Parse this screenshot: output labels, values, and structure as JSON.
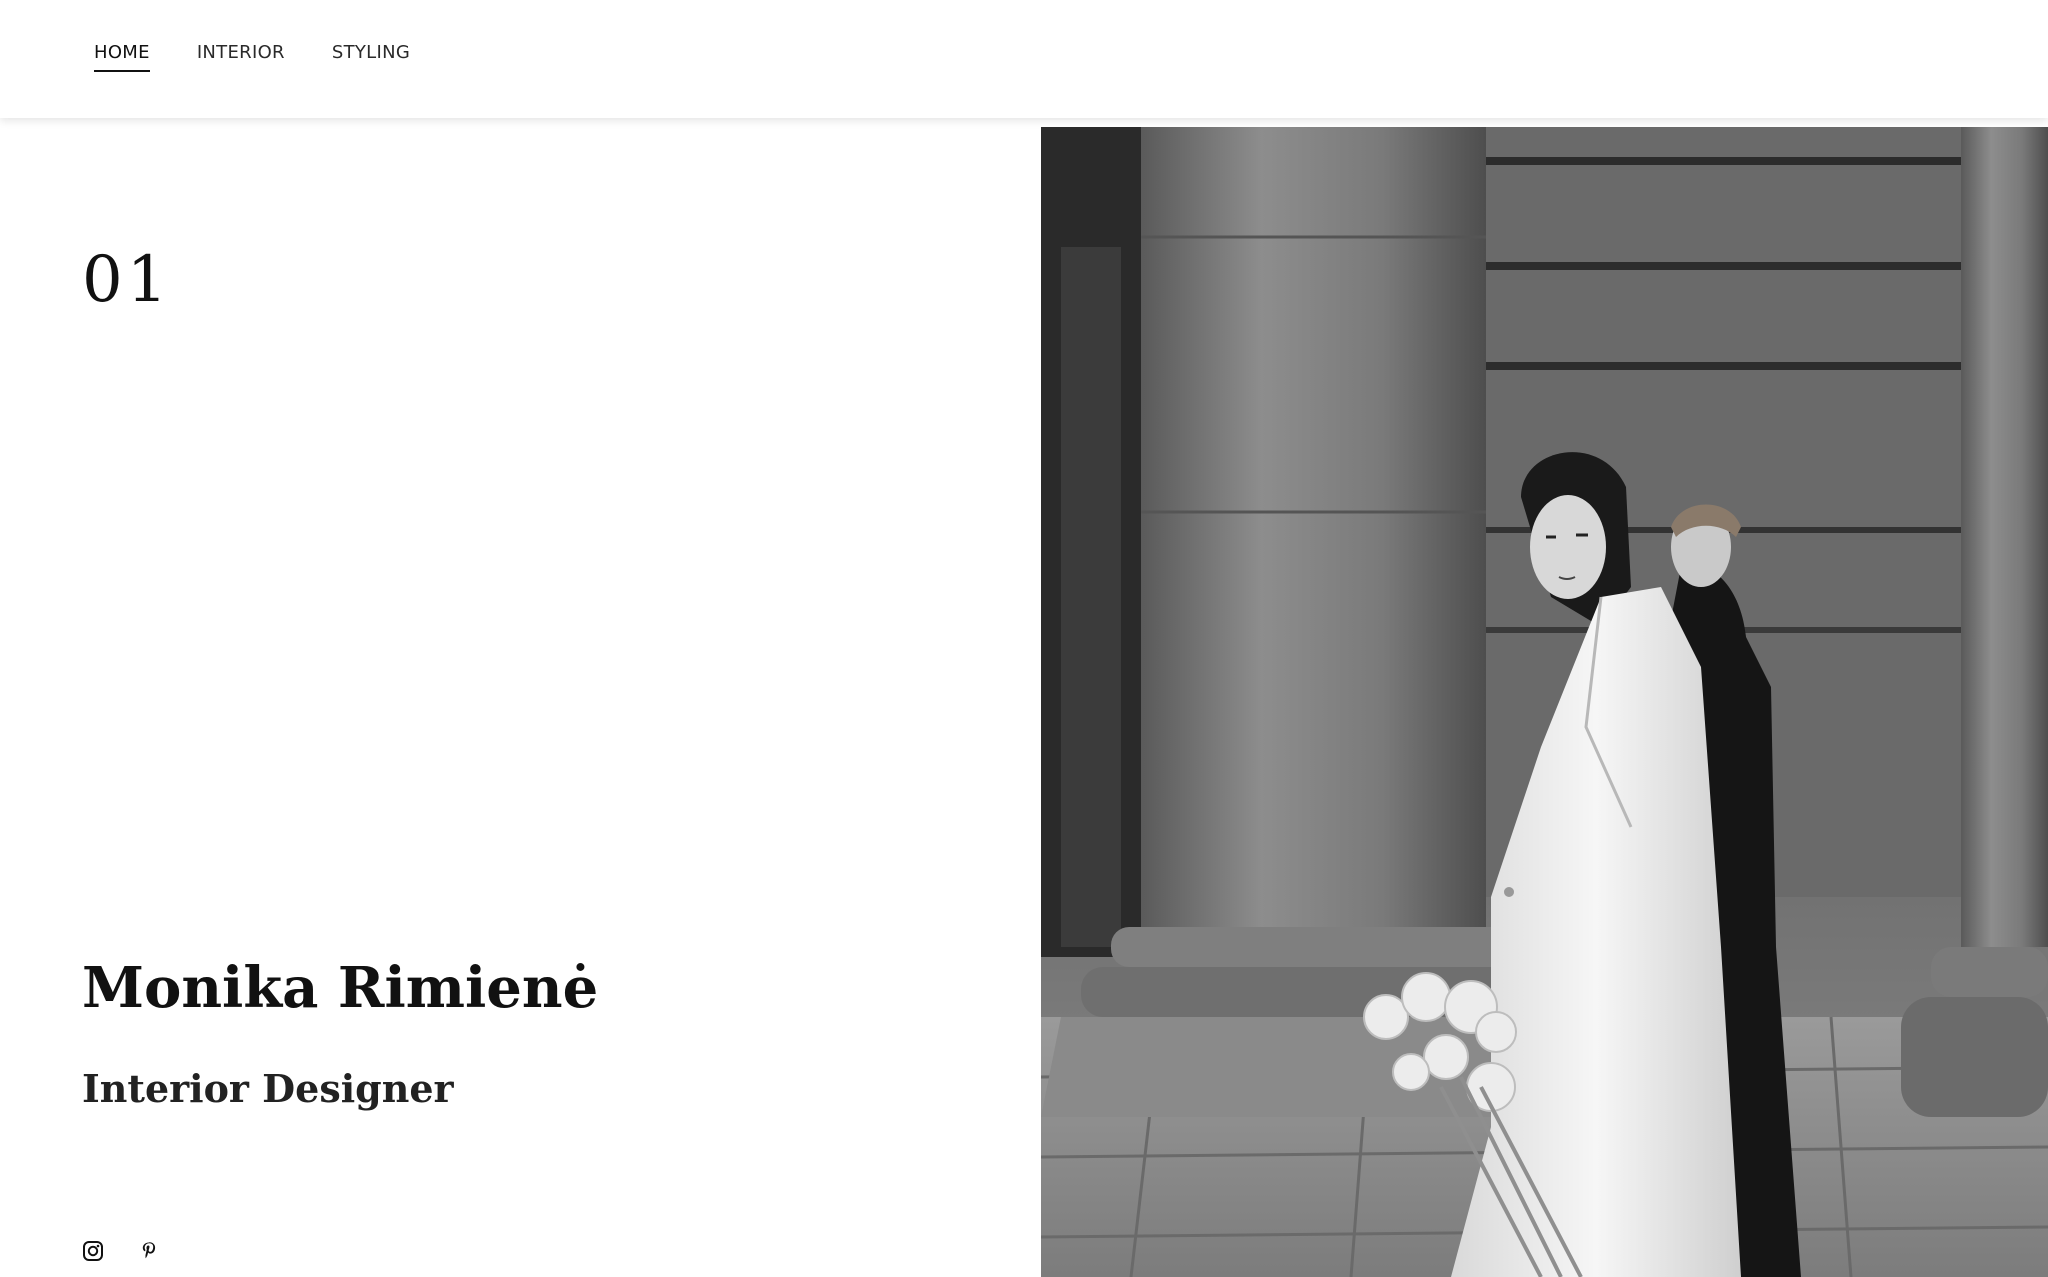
{
  "nav": {
    "items": [
      {
        "label": "HOME",
        "active": true
      },
      {
        "label": "INTERIOR",
        "active": false
      },
      {
        "label": "STYLING",
        "active": false
      }
    ]
  },
  "hero": {
    "number": "01",
    "name": "Monika Rimienė",
    "subtitle": "Interior Designer"
  },
  "social": [
    {
      "icon": "instagram-icon"
    },
    {
      "icon": "pinterest-icon"
    }
  ],
  "colors": {
    "text": "#111111",
    "background": "#ffffff",
    "photo_tone": "#6c6c6c"
  }
}
